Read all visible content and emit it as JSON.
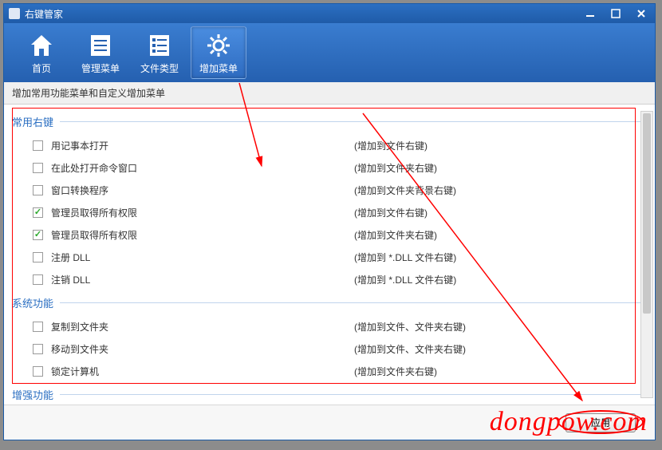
{
  "title": "右键管家",
  "toolbar": {
    "home": "首页",
    "manage": "管理菜单",
    "filetype": "文件类型",
    "addmenu": "增加菜单"
  },
  "subtitle": "增加常用功能菜单和自定义增加菜单",
  "groups": {
    "common": "常用右键",
    "system": "系统功能",
    "enhance": "增强功能"
  },
  "rows": {
    "r1": {
      "label": "用记事本打开",
      "desc": "(增加到文件右键)"
    },
    "r2": {
      "label": "在此处打开命令窗口",
      "desc": "(增加到文件夹右键)"
    },
    "r3": {
      "label": "窗口转换程序",
      "desc": "(增加到文件夹背景右键)"
    },
    "r4": {
      "label": "管理员取得所有权限",
      "desc": "(增加到文件右键)"
    },
    "r5": {
      "label": "管理员取得所有权限",
      "desc": "(增加到文件夹右键)"
    },
    "r6": {
      "label": "注册 DLL",
      "desc": "(增加到 *.DLL 文件右键)"
    },
    "r7": {
      "label": "注销 DLL",
      "desc": "(增加到 *.DLL 文件右键)"
    },
    "r8": {
      "label": "复制到文件夹",
      "desc": "(增加到文件、文件夹右键)"
    },
    "r9": {
      "label": "移动到文件夹",
      "desc": "(增加到文件、文件夹右键)"
    },
    "r10": {
      "label": "锁定计算机",
      "desc": "(增加到文件夹右键)"
    }
  },
  "apply": "应用",
  "watermark": "dongpow.com"
}
